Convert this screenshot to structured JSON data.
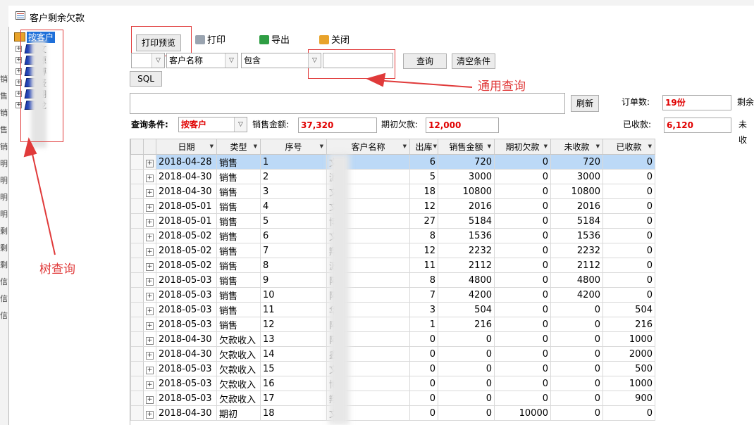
{
  "window": {
    "title": "客户剩余欠款"
  },
  "tree": {
    "root": "按客户",
    "items": [
      "文",
      "源",
      "博",
      "盛",
      "翔",
      "龙"
    ]
  },
  "toolbar": {
    "print_preview": "打印预览",
    "print": "打印",
    "export": "导出",
    "close": "关闭"
  },
  "filter": {
    "field": "客户名称",
    "operator": "包含",
    "value": "",
    "search": "查询",
    "clear": "清空条件",
    "sql": "SQL",
    "refresh": "刷新"
  },
  "summary": {
    "condition_label": "查询条件:",
    "condition_value": "按客户",
    "sales_label": "销售金额:",
    "sales_value": "37,320",
    "opening_label": "期初欠款:",
    "opening_value": "12,000",
    "orders_label": "订单数:",
    "orders_value": "19份",
    "received_label": "已收款:",
    "received_value": "6,120",
    "remaining_label": "剩余",
    "unreceived_label": "未收"
  },
  "annotations": {
    "tree": "树查询",
    "general": "通用查询"
  },
  "columns": [
    "日期",
    "类型",
    "序号",
    "客户名称",
    "出库",
    "销售金额",
    "期初欠款",
    "未收款",
    "已收款"
  ],
  "rows": [
    {
      "date": "2018-04-28",
      "type": "销售",
      "no": "1",
      "customer": "文",
      "qty": "6",
      "sales": "720",
      "opening": "0",
      "unpaid": "720",
      "paid": "0"
    },
    {
      "date": "2018-04-30",
      "type": "销售",
      "no": "2",
      "customer": "源",
      "qty": "5",
      "sales": "3000",
      "opening": "0",
      "unpaid": "3000",
      "paid": "0"
    },
    {
      "date": "2018-04-30",
      "type": "销售",
      "no": "3",
      "customer": "文",
      "qty": "18",
      "sales": "10800",
      "opening": "0",
      "unpaid": "10800",
      "paid": "0"
    },
    {
      "date": "2018-05-01",
      "type": "销售",
      "no": "4",
      "customer": "文",
      "qty": "12",
      "sales": "2016",
      "opening": "0",
      "unpaid": "2016",
      "paid": "0"
    },
    {
      "date": "2018-05-01",
      "type": "销售",
      "no": "5",
      "customer": "博",
      "qty": "27",
      "sales": "5184",
      "opening": "0",
      "unpaid": "5184",
      "paid": "0"
    },
    {
      "date": "2018-05-02",
      "type": "销售",
      "no": "6",
      "customer": "文",
      "qty": "8",
      "sales": "1536",
      "opening": "0",
      "unpaid": "1536",
      "paid": "0"
    },
    {
      "date": "2018-05-02",
      "type": "销售",
      "no": "7",
      "customer": "翔",
      "qty": "12",
      "sales": "2232",
      "opening": "0",
      "unpaid": "2232",
      "paid": "0"
    },
    {
      "date": "2018-05-02",
      "type": "销售",
      "no": "8",
      "customer": "源",
      "qty": "11",
      "sales": "2112",
      "opening": "0",
      "unpaid": "2112",
      "paid": "0"
    },
    {
      "date": "2018-05-03",
      "type": "销售",
      "no": "9",
      "customer": "阿",
      "qty": "8",
      "sales": "4800",
      "opening": "0",
      "unpaid": "4800",
      "paid": "0"
    },
    {
      "date": "2018-05-03",
      "type": "销售",
      "no": "10",
      "customer": "阿",
      "qty": "7",
      "sales": "4200",
      "opening": "0",
      "unpaid": "4200",
      "paid": "0"
    },
    {
      "date": "2018-05-03",
      "type": "销售",
      "no": "11",
      "customer": "华",
      "qty": "3",
      "sales": "504",
      "opening": "0",
      "unpaid": "0",
      "paid": "504"
    },
    {
      "date": "2018-05-03",
      "type": "销售",
      "no": "12",
      "customer": "阿",
      "qty": "1",
      "sales": "216",
      "opening": "0",
      "unpaid": "0",
      "paid": "216"
    },
    {
      "date": "2018-04-30",
      "type": "欠款收入",
      "no": "13",
      "customer": "阿",
      "qty": "0",
      "sales": "0",
      "opening": "0",
      "unpaid": "0",
      "paid": "1000"
    },
    {
      "date": "2018-04-30",
      "type": "欠款收入",
      "no": "14",
      "customer": "鑫",
      "qty": "0",
      "sales": "0",
      "opening": "0",
      "unpaid": "0",
      "paid": "2000"
    },
    {
      "date": "2018-05-03",
      "type": "欠款收入",
      "no": "15",
      "customer": "文",
      "qty": "0",
      "sales": "0",
      "opening": "0",
      "unpaid": "0",
      "paid": "500"
    },
    {
      "date": "2018-05-03",
      "type": "欠款收入",
      "no": "16",
      "customer": "博",
      "qty": "0",
      "sales": "0",
      "opening": "0",
      "unpaid": "0",
      "paid": "1000"
    },
    {
      "date": "2018-05-03",
      "type": "欠款收入",
      "no": "17",
      "customer": "翔",
      "qty": "0",
      "sales": "0",
      "opening": "0",
      "unpaid": "0",
      "paid": "900"
    },
    {
      "date": "2018-04-30",
      "type": "期初",
      "no": "18",
      "customer": "文",
      "qty": "0",
      "sales": "0",
      "opening": "10000",
      "unpaid": "0",
      "paid": "0"
    }
  ],
  "background_sidebar": [
    "销",
    "售",
    "销",
    "售",
    "销",
    "明",
    "明",
    "明",
    "明",
    "剩",
    "剩",
    "剩",
    "信",
    "信",
    "信"
  ]
}
